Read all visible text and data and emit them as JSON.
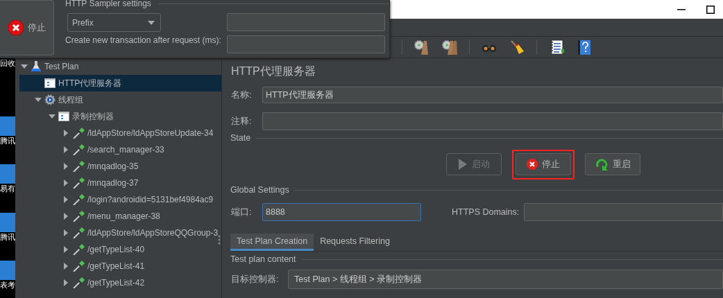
{
  "desktop_icons": [
    {
      "label": "回收"
    },
    {
      "label": "腾讯"
    },
    {
      "label": "易有"
    },
    {
      "label": "腾讯"
    },
    {
      "label": "表考"
    }
  ],
  "recorder_popup": {
    "stop_button": "停止",
    "group_title": "HTTP Sampler settings",
    "naming_scheme": "Prefix",
    "transaction_label": "Create new transaction after request (ms):"
  },
  "tree": {
    "items": [
      {
        "label": "Test Plan",
        "kind": "plan",
        "expanded": true,
        "selected": false,
        "children": [
          {
            "label": "HTTP代理服务器",
            "kind": "proxy",
            "selected": true
          },
          {
            "label": "线程组",
            "kind": "group",
            "expanded": true,
            "selected": false,
            "children": [
              {
                "label": "录制控制器",
                "kind": "controller",
                "expanded": true,
                "selected": false,
                "children": [
                  {
                    "label": "/ldAppStore/ldAppStoreUpdate-34",
                    "kind": "sampler",
                    "expanded": false,
                    "selected": false
                  },
                  {
                    "label": "/search_manager-33",
                    "kind": "sampler",
                    "expanded": false,
                    "selected": false
                  },
                  {
                    "label": "/mnqadlog-35",
                    "kind": "sampler",
                    "expanded": false,
                    "selected": false
                  },
                  {
                    "label": "/mnqadlog-37",
                    "kind": "sampler",
                    "expanded": false,
                    "selected": false
                  },
                  {
                    "label": "/login?androidid=5131bef4984ac9",
                    "kind": "sampler",
                    "expanded": false,
                    "selected": false
                  },
                  {
                    "label": "/menu_manager-38",
                    "kind": "sampler",
                    "expanded": false,
                    "selected": false
                  },
                  {
                    "label": "/ldAppStore/ldAppStoreQQGroup-3",
                    "kind": "sampler",
                    "expanded": false,
                    "selected": false
                  },
                  {
                    "label": "/getTypeList-40",
                    "kind": "sampler",
                    "expanded": false,
                    "selected": false
                  },
                  {
                    "label": "/getTypeList-41",
                    "kind": "sampler",
                    "expanded": false,
                    "selected": false
                  },
                  {
                    "label": "/getTypeList-42",
                    "kind": "sampler",
                    "expanded": false,
                    "selected": false
                  }
                ]
              }
            ]
          }
        ]
      }
    ]
  },
  "panel": {
    "title": "HTTP代理服务器",
    "name": {
      "label": "名称:",
      "value": "HTTP代理服务器"
    },
    "comment": {
      "label": "注释:"
    },
    "state": {
      "title": "State",
      "buttons": [
        {
          "label": "启动",
          "kind": "start",
          "disabled": true,
          "highlighted": false
        },
        {
          "label": "停止",
          "kind": "stop",
          "disabled": false,
          "highlighted": true
        },
        {
          "label": "重启",
          "kind": "restart",
          "disabled": false,
          "highlighted": false
        }
      ]
    },
    "global_settings": {
      "title": "Global Settings",
      "port": {
        "label": "端口:",
        "value": "8888",
        "focused": true
      },
      "https_domains": {
        "label": "HTTPS Domains:"
      }
    },
    "tabs": [
      {
        "label": "Test Plan Creation",
        "selected": true
      },
      {
        "label": "Requests Filtering",
        "selected": false
      }
    ],
    "test_plan_content": {
      "title": "Test plan content",
      "target_controller": {
        "label": "目标控制器:",
        "value": "Test Plan > 线程组 > 录制控制器"
      }
    }
  }
}
